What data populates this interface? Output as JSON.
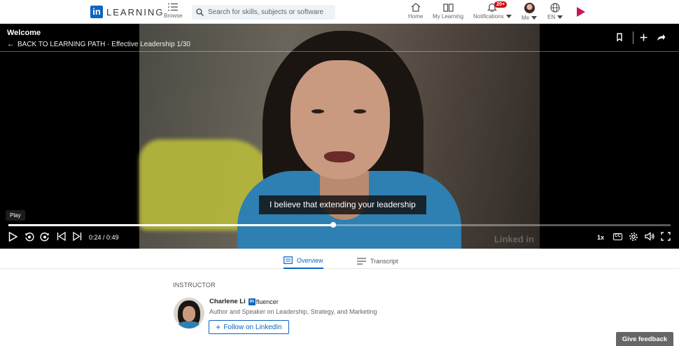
{
  "nav": {
    "logo_letters": "in",
    "logo_text": "LEARNING",
    "browse_label": "Browse",
    "search_placeholder": "Search for skills, subjects or software",
    "home_label": "Home",
    "my_learning_label": "My Learning",
    "notifications_label": "Notifications",
    "notifications_badge": "20+",
    "me_label": "Me",
    "language_label": "EN"
  },
  "video": {
    "title": "Welcome",
    "back_label": "BACK TO LEARNING PATH · Effective Leadership 1/30",
    "caption": "I believe that extending your leadership",
    "play_tooltip": "Play",
    "time": "0:24 / 0:49",
    "progress_fraction": 0.49,
    "speed": "1x",
    "cc_label": "CC",
    "watermark": "Linked in"
  },
  "tabs": [
    {
      "label": "Overview",
      "active": true
    },
    {
      "label": "Transcript",
      "active": false
    }
  ],
  "instructor": {
    "section_label": "INSTRUCTOR",
    "name": "Charlene Li",
    "badge_letters": "in",
    "badge_suffix": "fluencer",
    "description": "Author and Speaker on Leadership, Strategy, and Marketing",
    "follow_label": "Follow on LinkedIn"
  },
  "feedback_label": "Give feedback",
  "colors": {
    "brand": "#0a66c2",
    "notification": "#cc1016",
    "premium": "#c2185b"
  }
}
